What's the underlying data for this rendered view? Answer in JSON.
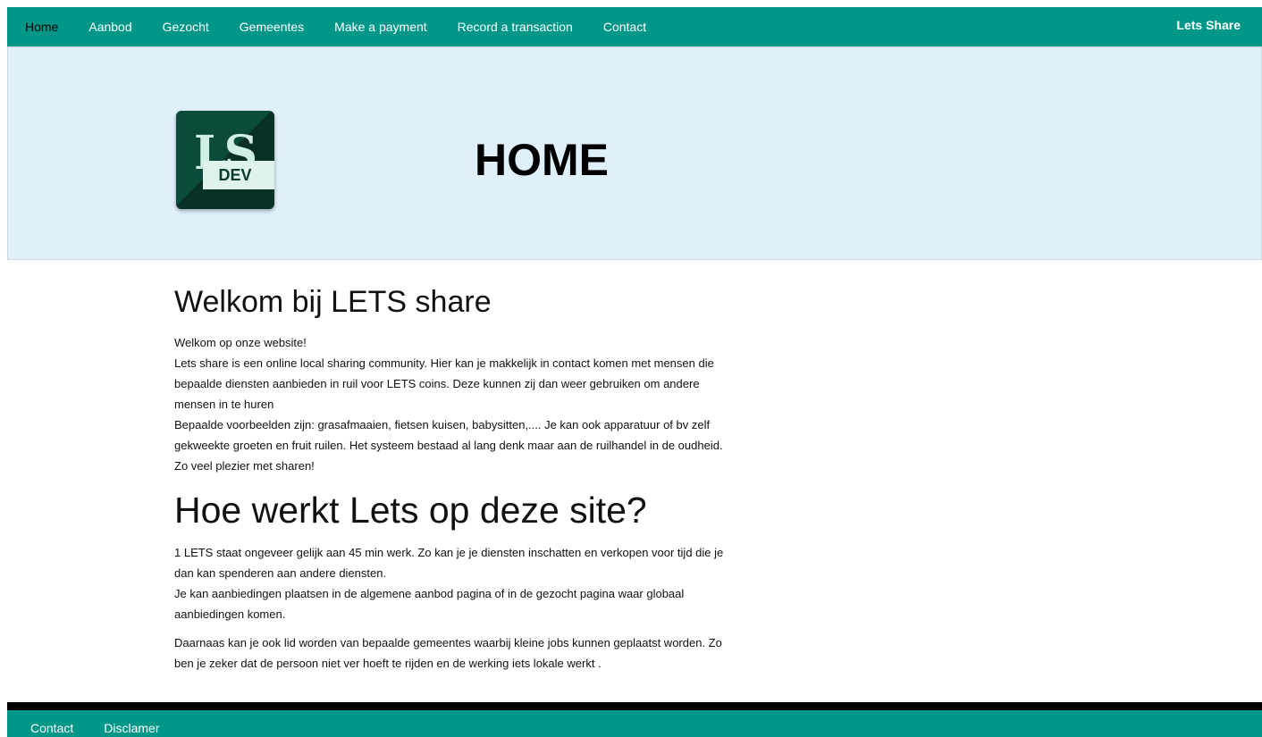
{
  "nav": {
    "items": [
      {
        "label": "Home",
        "active": true
      },
      {
        "label": "Aanbod"
      },
      {
        "label": "Gezocht"
      },
      {
        "label": "Gemeentes"
      },
      {
        "label": "Make a payment"
      },
      {
        "label": "Record a transaction"
      },
      {
        "label": "Contact"
      }
    ],
    "brand": "Lets Share"
  },
  "hero": {
    "logo_letters": "LS",
    "logo_tag": "DEV",
    "title": "HOME"
  },
  "content": {
    "welcome_heading": "Welkom bij LETS share",
    "welcome_lines": [
      "Welkom op onze website!",
      "Lets share is een online local sharing community. Hier kan je makkelijk in contact komen met mensen die",
      "bepaalde diensten aanbieden in ruil voor LETS coins. Deze kunnen zij dan weer gebruiken om andere",
      "mensen in te huren",
      "Bepaalde voorbeelden zijn: grasafmaaien, fietsen kuisen, babysitten,.... Je kan ook apparatuur of bv zelf",
      "gekweekte groeten en fruit ruilen. Het systeem bestaad al lang denk maar aan de ruilhandel in de oudheid.",
      "Zo veel plezier met sharen!"
    ],
    "how_heading": "Hoe werkt Lets op deze site?",
    "how_lines_1": [
      "1 LETS staat ongeveer gelijk aan 45 min werk. Zo kan je je diensten inschatten en verkopen voor tijd die je",
      "dan kan spenderen aan andere diensten.",
      "Je kan aanbiedingen plaatsen in de algemene aanbod pagina of in de gezocht pagina waar globaal",
      "aanbiedingen komen."
    ],
    "how_lines_2": [
      "Daarnaas kan je ook lid worden van bepaalde gemeentes waarbij kleine jobs kunnen geplaatst worden. Zo",
      "ben je zeker dat de persoon niet ver hoeft te rijden en de werking iets lokale werkt ."
    ]
  },
  "footer": {
    "links": [
      "Contact",
      "Disclamer"
    ]
  },
  "colors": {
    "primary": "#009688",
    "hero_bg": "#dff0fb",
    "logo_bg": "#0c4a3c"
  }
}
